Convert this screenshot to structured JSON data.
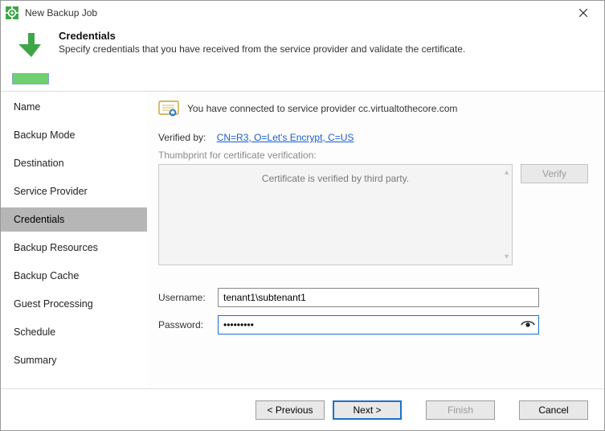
{
  "window": {
    "title": "New Backup Job"
  },
  "header": {
    "heading": "Credentials",
    "subheading": "Specify credentials that you have received from the service provider and validate the certificate."
  },
  "sidebar": {
    "steps": [
      {
        "label": "Name"
      },
      {
        "label": "Backup Mode"
      },
      {
        "label": "Destination"
      },
      {
        "label": "Service Provider"
      },
      {
        "label": "Credentials",
        "active": true
      },
      {
        "label": "Backup Resources"
      },
      {
        "label": "Backup Cache"
      },
      {
        "label": "Guest Processing"
      },
      {
        "label": "Schedule"
      },
      {
        "label": "Summary"
      }
    ]
  },
  "content": {
    "connected_msg": "You have connected to service provider cc.virtualtothecore.com",
    "verified_by_label": "Verified by:",
    "verified_by_link": "CN=R3, O=Let's Encrypt, C=US",
    "thumbprint_section_label": "Thumbprint for certificate verification:",
    "thumbprint_msg": "Certificate is verified by third party.",
    "verify_button": "Verify",
    "username_label": "Username:",
    "username_value": "tenant1\\subtenant1",
    "password_label": "Password:",
    "password_value": "•••••••••"
  },
  "footer": {
    "previous": "< Previous",
    "next": "Next >",
    "finish": "Finish",
    "cancel": "Cancel"
  }
}
